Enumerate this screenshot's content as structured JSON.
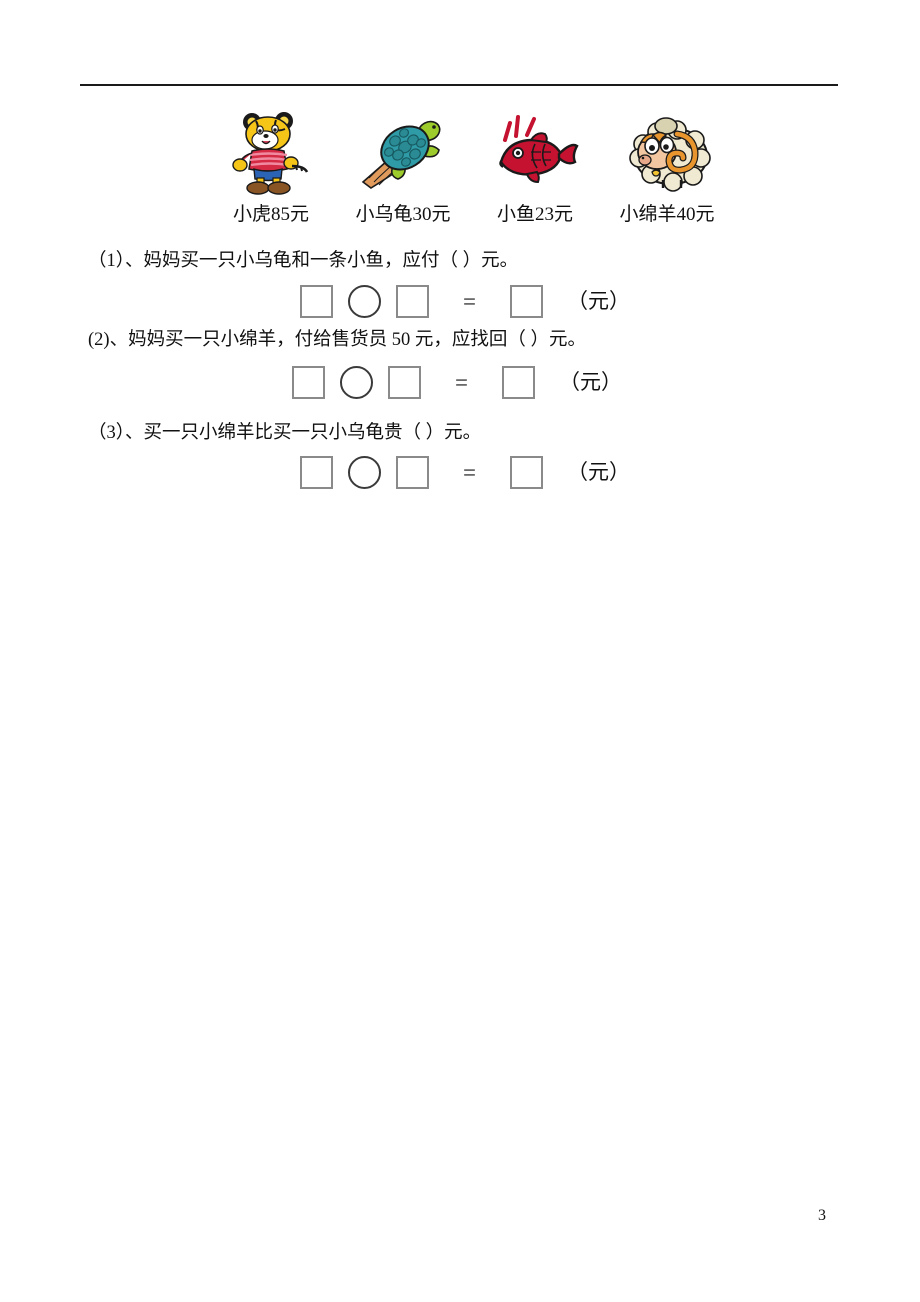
{
  "page": {
    "number": "3",
    "rule_color": "#1a1a1a"
  },
  "price_list": {
    "items": [
      {
        "icon": "tiger-cartoon-icon",
        "name": "小虎",
        "price": "85",
        "unit": "元",
        "caption": "小虎85元"
      },
      {
        "icon": "turtle-cartoon-icon",
        "name": "小乌龟",
        "price": "30",
        "unit": "元",
        "caption": "小乌龟30元"
      },
      {
        "icon": "fish-cartoon-icon",
        "name": "小鱼",
        "price": "23",
        "unit": "元",
        "caption": "小鱼23元"
      },
      {
        "icon": "sheep-cartoon-icon",
        "name": "小绵羊",
        "price": "40",
        "unit": "元",
        "caption": "小绵羊40元"
      }
    ]
  },
  "questions": [
    {
      "text": "（1）、妈妈买一只小乌龟和一条小鱼，应付（    ）元。",
      "answer": {
        "operand1_placeholder": "",
        "operator_placeholder": "",
        "operand2_placeholder": "",
        "equals": "=",
        "result_placeholder": "",
        "unit": "（元）"
      }
    },
    {
      "text": "(2)、妈妈买一只小绵羊，付给售货员 50 元，应找回（    ）元。",
      "answer": {
        "operand1_placeholder": "",
        "operator_placeholder": "",
        "operand2_placeholder": "",
        "equals": "=",
        "result_placeholder": "",
        "unit": "（元）"
      }
    },
    {
      "text": "（3）、买一只小绵羊比买一只小乌龟贵（    ）元。",
      "answer": {
        "operand1_placeholder": "",
        "operator_placeholder": "",
        "operand2_placeholder": "",
        "equals": "=",
        "result_placeholder": "",
        "unit": "（元）"
      }
    }
  ],
  "colors": {
    "tiger_body": "#f5c518",
    "tiger_shirt": "#d42a43",
    "turtle_shell": "#2e9ba6",
    "turtle_limb": "#9ccb2b",
    "fish_body": "#c41230",
    "sheep_wool": "#f0ead2",
    "sheep_horn": "#e8952e",
    "box_border": "#8a8a8a"
  }
}
